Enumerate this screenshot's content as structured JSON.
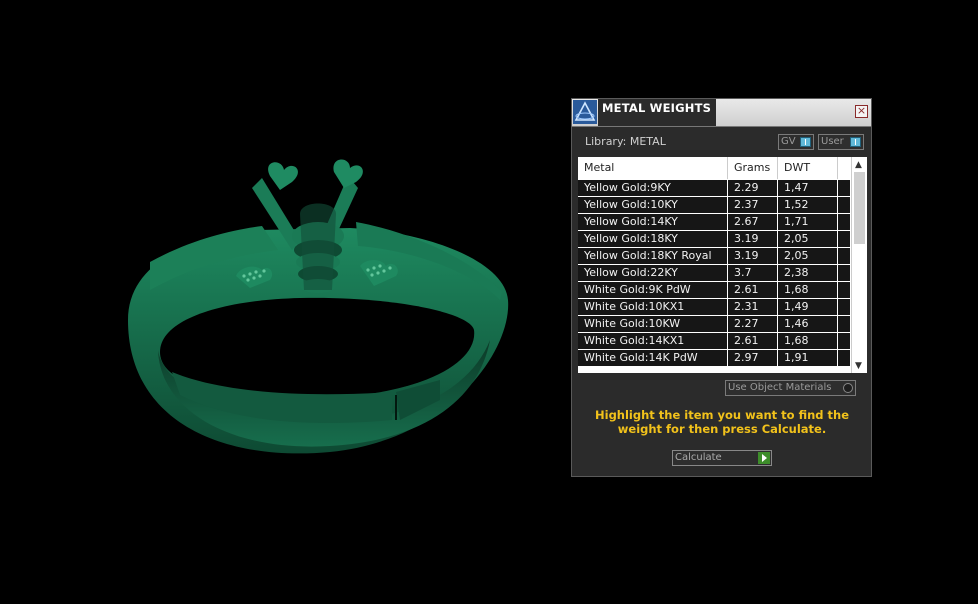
{
  "panel": {
    "title": "METAL WEIGHTS",
    "close_glyph": "×",
    "library_label": "Library: METAL",
    "toggles": {
      "gv": "GV",
      "user": "User"
    },
    "columns": [
      "Metal",
      "Grams",
      "DWT"
    ],
    "rows": [
      {
        "metal": "Yellow Gold:9KY",
        "grams": "2.29",
        "dwt": "1,47"
      },
      {
        "metal": "Yellow Gold:10KY",
        "grams": "2.37",
        "dwt": "1,52"
      },
      {
        "metal": "Yellow Gold:14KY",
        "grams": "2.67",
        "dwt": "1,71"
      },
      {
        "metal": "Yellow Gold:18KY",
        "grams": "3.19",
        "dwt": "2,05"
      },
      {
        "metal": "Yellow Gold:18KY Royal",
        "grams": "3.19",
        "dwt": "2,05"
      },
      {
        "metal": "Yellow Gold:22KY",
        "grams": "3.7",
        "dwt": "2,38"
      },
      {
        "metal": "White Gold:9K PdW",
        "grams": "2.61",
        "dwt": "1,68"
      },
      {
        "metal": "White Gold:10KX1",
        "grams": "2.31",
        "dwt": "1,49"
      },
      {
        "metal": "White Gold:10KW",
        "grams": "2.27",
        "dwt": "1,46"
      },
      {
        "metal": "White Gold:14KX1",
        "grams": "2.61",
        "dwt": "1,68"
      },
      {
        "metal": "White Gold:14K PdW",
        "grams": "2.97",
        "dwt": "1,91"
      }
    ],
    "use_object_materials": "Use Object Materials",
    "hint": "Highlight the item you want to find the weight for then press Calculate.",
    "calculate_label": "Calculate",
    "icons": {
      "app": "pyramid-logo-icon",
      "close": "close-icon",
      "toggle": "toggle-knob-icon",
      "scroll_up": "scroll-up-arrow-icon",
      "scroll_down": "scroll-down-arrow-icon",
      "calculate": "play-arrow-icon"
    },
    "colors": {
      "ring": "#1a7a55",
      "hint": "#f2c21b",
      "accent": "#5fb8d8",
      "calculate": "#3d8d2a"
    }
  }
}
